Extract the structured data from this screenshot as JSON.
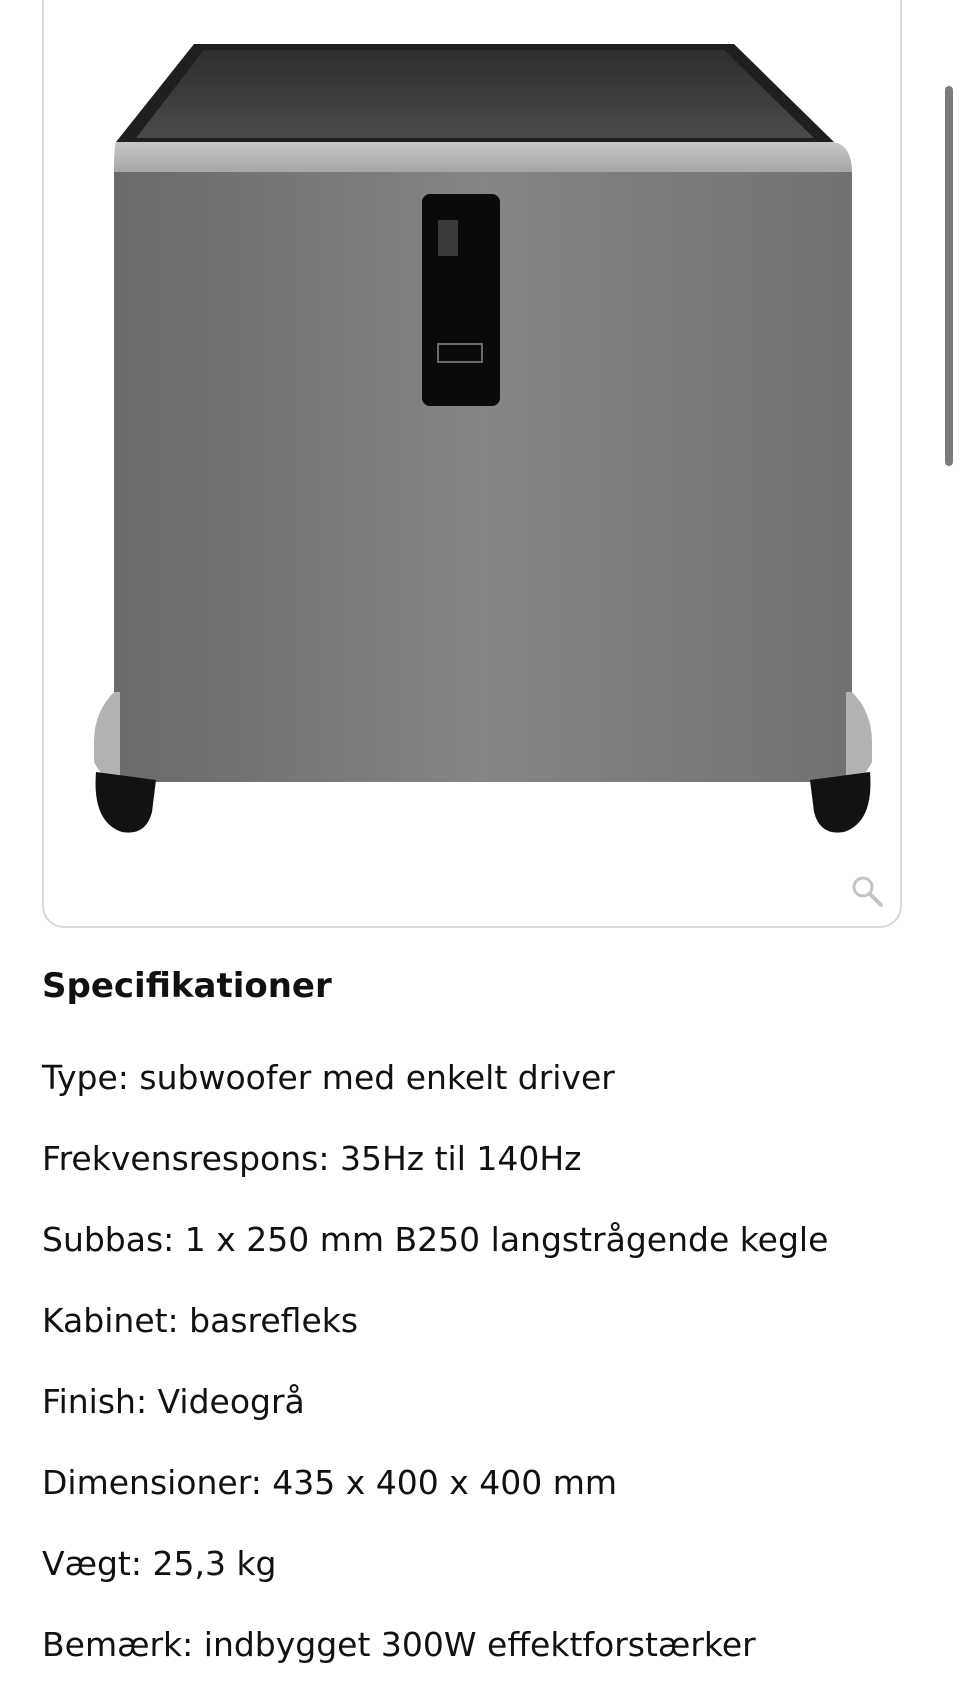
{
  "product_image": {
    "alt": "",
    "colors": {
      "body": "#7c7c7c",
      "top": "#3c3c3c",
      "trim": "#b9b9b9",
      "display": "#0a0a0a",
      "feet": "#111111"
    }
  },
  "zoom": {
    "icon": "magnifier-icon"
  },
  "specs": {
    "title": "Specifikationer",
    "items": [
      {
        "text": "Type: subwoofer med enkelt driver"
      },
      {
        "text": "Frekvensrespons: 35Hz til 140Hz"
      },
      {
        "text": "Subbas: 1 x 250 mm B250 langstrågende kegle"
      },
      {
        "text": "Kabinet: basrefleks"
      },
      {
        "text": "Finish: Videogrå"
      },
      {
        "text": "Dimensioner: 435 x 400 x 400 mm"
      },
      {
        "text": "Vægt: 25,3 kg"
      },
      {
        "text": "Bemærk: indbygget 300W effektforstærker"
      }
    ]
  }
}
